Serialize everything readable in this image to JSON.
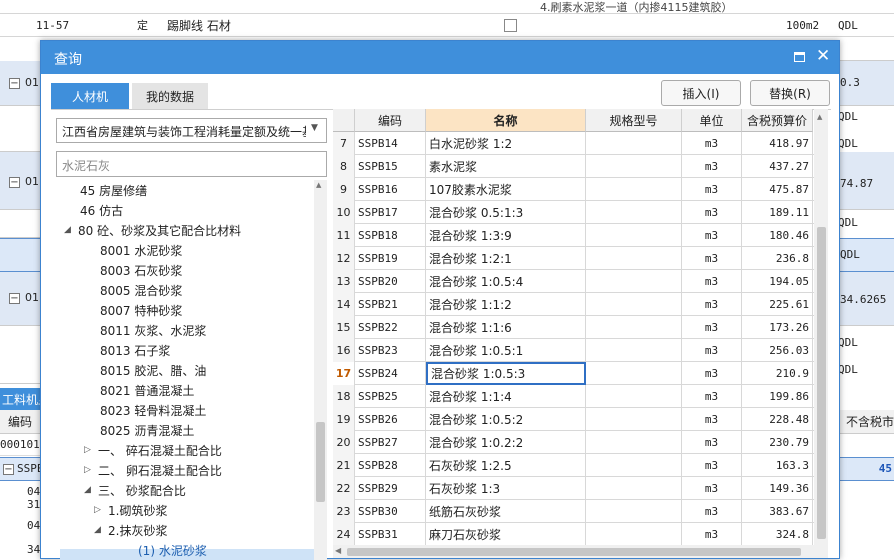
{
  "background": {
    "top_text": "4.刷素水泥浆一道（内掺4115建筑胶）",
    "row1": {
      "code": "11-57",
      "type": "定",
      "name": "踢脚线 石材",
      "unit": "100m2",
      "src": "QDL"
    },
    "col_vals": [
      "0.3",
      "74.87",
      "34.6265"
    ],
    "qdl": "QDL",
    "prefix01": "01",
    "footer_tab": "工料机显",
    "footer_col1": "编码",
    "footer_code": "0001010",
    "footer_sspe": "SSPE",
    "footer_rows": [
      "04",
      "31",
      "04",
      "34"
    ],
    "right_header": "不含税市",
    "right_val": "45"
  },
  "dialog": {
    "title": "查询",
    "tabs": [
      "人材机",
      "我的数据"
    ],
    "insert_btn": "插入(I)",
    "replace_btn": "替换(R)",
    "dropdown_value": "江西省房屋建筑与装饰工程消耗量定额及统一基",
    "search_value": "水泥石灰",
    "tree": [
      {
        "label": "45 房屋修缮",
        "level": 1,
        "arrow": ""
      },
      {
        "label": "46 仿古",
        "level": 1,
        "arrow": ""
      },
      {
        "label": "80 砼、砂浆及其它配合比材料",
        "level": 1,
        "arrow": "◢"
      },
      {
        "label": "8001 水泥砂浆",
        "level": 2,
        "arrow": ""
      },
      {
        "label": "8003 石灰砂浆",
        "level": 2,
        "arrow": ""
      },
      {
        "label": "8005 混合砂浆",
        "level": 2,
        "arrow": ""
      },
      {
        "label": "8007 特种砂浆",
        "level": 2,
        "arrow": ""
      },
      {
        "label": "8011 灰浆、水泥浆",
        "level": 2,
        "arrow": ""
      },
      {
        "label": "8013 石子浆",
        "level": 2,
        "arrow": ""
      },
      {
        "label": "8015 胶泥、腊、油",
        "level": 2,
        "arrow": ""
      },
      {
        "label": "8021 普通混凝土",
        "level": 2,
        "arrow": ""
      },
      {
        "label": "8023 轻骨料混凝土",
        "level": 2,
        "arrow": ""
      },
      {
        "label": "8025 沥青混凝土",
        "level": 2,
        "arrow": ""
      },
      {
        "label": "一、 碎石混凝土配合比",
        "level": 2,
        "arrow": "▷"
      },
      {
        "label": "二、 卵石混凝土配合比",
        "level": 2,
        "arrow": "▷"
      },
      {
        "label": "三、 砂浆配合比",
        "level": 2,
        "arrow": "◢"
      },
      {
        "label": "1.砌筑砂浆",
        "level": 3,
        "arrow": "▷"
      },
      {
        "label": "2.抹灰砂浆",
        "level": 3,
        "arrow": "◢"
      },
      {
        "label": "(1) 水泥砂浆",
        "level": 4,
        "arrow": ""
      }
    ],
    "grid_headers": [
      "",
      "编码",
      "名称",
      "规格型号",
      "单位",
      "含税预算价"
    ],
    "rows": [
      {
        "n": "7",
        "code": "SSPB14",
        "name": "白水泥砂浆 1:2",
        "unit": "m3",
        "price": "418.97"
      },
      {
        "n": "8",
        "code": "SSPB15",
        "name": "素水泥浆",
        "unit": "m3",
        "price": "437.27"
      },
      {
        "n": "9",
        "code": "SSPB16",
        "name": "107胶素水泥浆",
        "unit": "m3",
        "price": "475.87"
      },
      {
        "n": "10",
        "code": "SSPB17",
        "name": "混合砂浆 0.5:1:3",
        "unit": "m3",
        "price": "189.11"
      },
      {
        "n": "11",
        "code": "SSPB18",
        "name": "混合砂浆 1:3:9",
        "unit": "m3",
        "price": "180.46"
      },
      {
        "n": "12",
        "code": "SSPB19",
        "name": "混合砂浆 1:2:1",
        "unit": "m3",
        "price": "236.8"
      },
      {
        "n": "13",
        "code": "SSPB20",
        "name": "混合砂浆 1:0.5:4",
        "unit": "m3",
        "price": "194.05"
      },
      {
        "n": "14",
        "code": "SSPB21",
        "name": "混合砂浆 1:1:2",
        "unit": "m3",
        "price": "225.61"
      },
      {
        "n": "15",
        "code": "SSPB22",
        "name": "混合砂浆 1:1:6",
        "unit": "m3",
        "price": "173.26"
      },
      {
        "n": "16",
        "code": "SSPB23",
        "name": "混合砂浆 1:0.5:1",
        "unit": "m3",
        "price": "256.03"
      },
      {
        "n": "17",
        "code": "SSPB24",
        "name": "混合砂浆 1:0.5:3",
        "unit": "m3",
        "price": "210.9"
      },
      {
        "n": "18",
        "code": "SSPB25",
        "name": "混合砂浆 1:1:4",
        "unit": "m3",
        "price": "199.86"
      },
      {
        "n": "19",
        "code": "SSPB26",
        "name": "混合砂浆 1:0.5:2",
        "unit": "m3",
        "price": "228.48"
      },
      {
        "n": "20",
        "code": "SSPB27",
        "name": "混合砂浆 1:0.2:2",
        "unit": "m3",
        "price": "230.79"
      },
      {
        "n": "21",
        "code": "SSPB28",
        "name": "石灰砂浆 1:2.5",
        "unit": "m3",
        "price": "163.3"
      },
      {
        "n": "22",
        "code": "SSPB29",
        "name": "石灰砂浆 1:3",
        "unit": "m3",
        "price": "149.36"
      },
      {
        "n": "23",
        "code": "SSPB30",
        "name": "纸筋石灰砂浆",
        "unit": "m3",
        "price": "383.67"
      },
      {
        "n": "24",
        "code": "SSPB31",
        "name": "麻刀石灰砂浆",
        "unit": "m3",
        "price": "324.8"
      }
    ],
    "selected_row": "17"
  },
  "colors": {
    "title_bar": "#3f8fdb",
    "active_tab": "#3f8fdb",
    "name_header": "#fce4c4",
    "tree_selected": "#cfe3f7"
  }
}
